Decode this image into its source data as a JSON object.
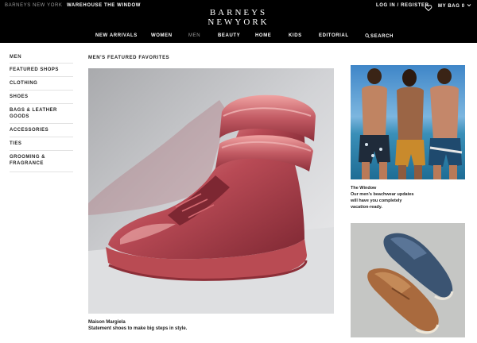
{
  "topbar": {
    "brand_link": "BARNEYS NEW YORK",
    "warehouse": "WAREHOUSE",
    "the_window": "THE WINDOW",
    "login": "LOG IN / REGISTER",
    "bag": "MY BAG 0",
    "logo_line1": "BARNEYS",
    "logo_line2": "NEWYORK"
  },
  "nav": [
    "NEW ARRIVALS",
    "WOMEN",
    "MEN",
    "BEAUTY",
    "HOME",
    "KIDS",
    "EDITORIAL",
    "SEARCH"
  ],
  "sidebar": {
    "title": "MEN",
    "items": [
      "FEATURED SHOPS",
      "CLOTHING",
      "SHOES",
      "BAGS & LEATHER GOODS",
      "ACCESSORIES",
      "TIES",
      "GROOMING &",
      "FRAGRANCE"
    ]
  },
  "main": {
    "heading": "MEN'S FEATURED FAVORITES",
    "caption_title": "Maison Margiela",
    "caption_text": "Statement shoes to make big steps in style."
  },
  "window_feature": {
    "title": "The Window",
    "description": "Our men's beachwear updates will have you completely vacation-ready."
  },
  "colors": {
    "topbar_bg": "#000000",
    "accent_sneaker": "#c0545c",
    "divider": "#e2e2e2"
  },
  "icons": [
    "heart-icon",
    "chevron-down-icon",
    "search-icon"
  ]
}
